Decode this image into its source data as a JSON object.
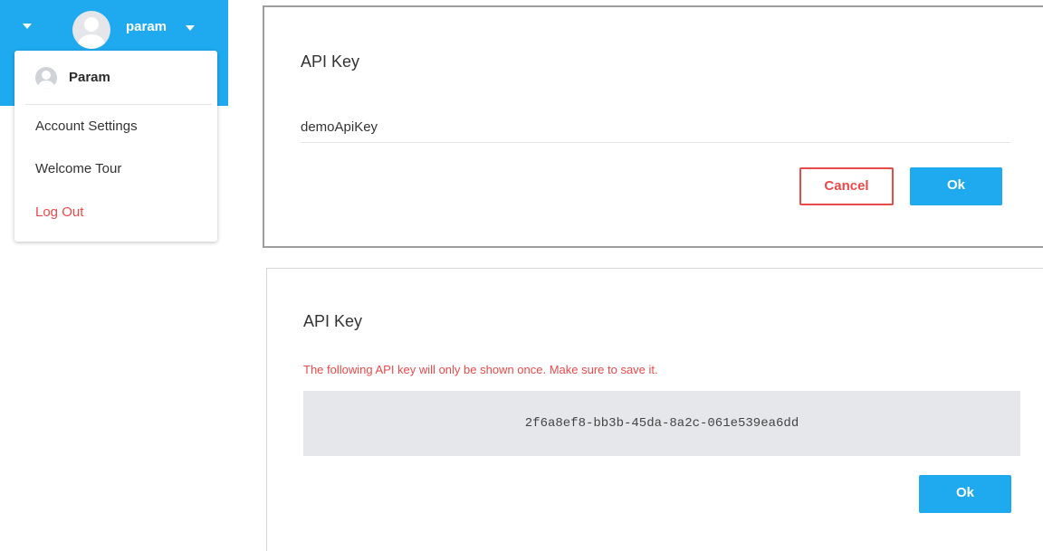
{
  "user_menu": {
    "username": "param",
    "display_name": "Param",
    "items": [
      {
        "label": "Account Settings"
      },
      {
        "label": "Welcome Tour"
      },
      {
        "label": "Log Out"
      }
    ]
  },
  "modal_edit": {
    "title": "API Key",
    "input_value": "demoApiKey",
    "cancel_label": "Cancel",
    "ok_label": "Ok"
  },
  "modal_created": {
    "title": "API Key",
    "warning": "The following API key will only be shown once. Make sure to save it.",
    "api_key": "2f6a8ef8-bb3b-45da-8a2c-061e539ea6dd",
    "ok_label": "Ok"
  },
  "colors": {
    "accent": "#1faaf0",
    "danger": "#e84a4a",
    "key_box_bg": "#e5e7ea"
  }
}
